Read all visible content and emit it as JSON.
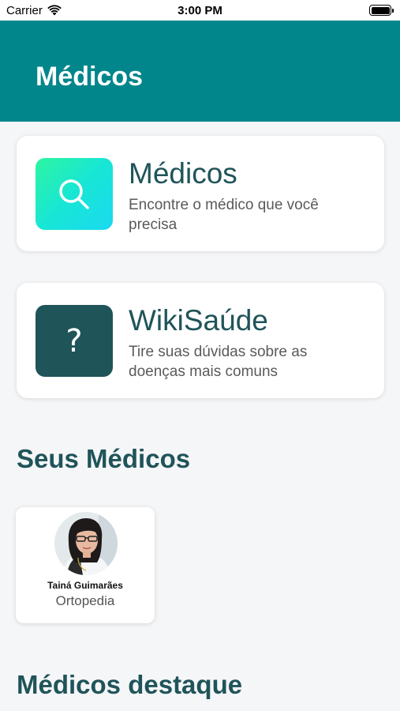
{
  "status_bar": {
    "carrier": "Carrier",
    "time": "3:00 PM"
  },
  "header": {
    "title": "Médicos"
  },
  "cards": [
    {
      "title": "Médicos",
      "subtitle": "Encontre o médico que você precisa",
      "icon": "search-icon"
    },
    {
      "title": "WikiSaúde",
      "subtitle": "Tire suas dúvidas sobre as doenças mais comuns",
      "icon_text": "?"
    }
  ],
  "sections": {
    "my_doctors": "Seus Médicos",
    "featured": "Médicos destaque"
  },
  "doctors": [
    {
      "name": "Tainá Guimarães",
      "specialty": "Ortopedia"
    }
  ],
  "colors": {
    "header": "#00868b",
    "title_text": "#1f5459",
    "icon_dark": "#1f5459",
    "background": "#f5f6f8"
  }
}
